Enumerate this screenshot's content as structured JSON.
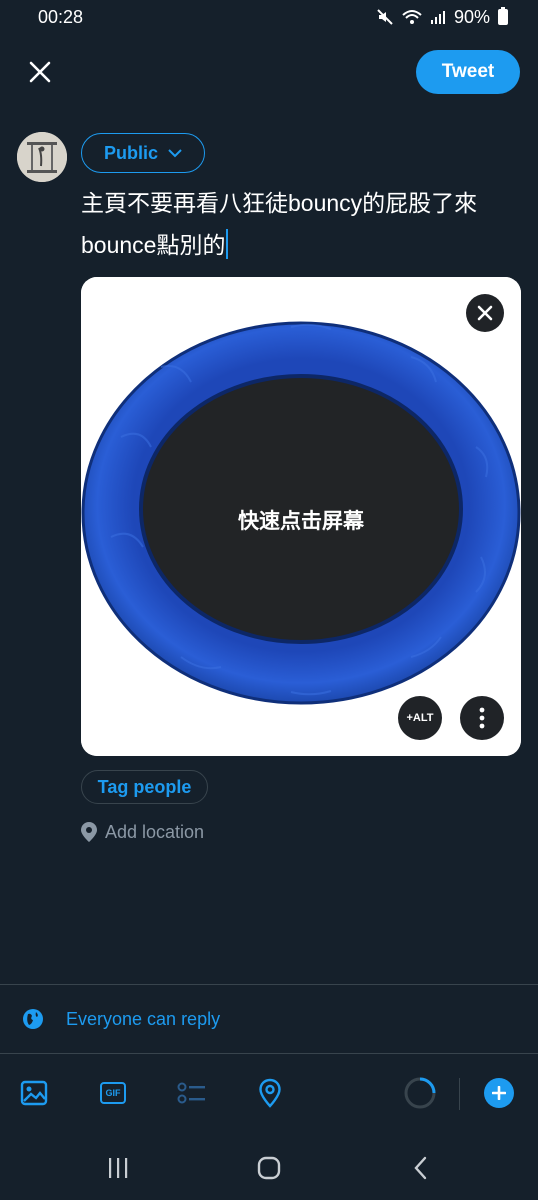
{
  "status_bar": {
    "time": "00:28",
    "battery": "90%"
  },
  "header": {
    "tweet_label": "Tweet"
  },
  "composer": {
    "audience_label": "Public",
    "text_line1": "主頁不要再看八狂徒bouncy的屁股了來",
    "text_line2": "bounce點別的"
  },
  "media": {
    "overlay_text": "快速点击屏幕",
    "alt_label": "+ALT"
  },
  "actions": {
    "tag_people": "Tag people",
    "add_location": "Add location"
  },
  "reply_settings": {
    "label": "Everyone can reply"
  },
  "colors": {
    "background": "#15202b",
    "accent": "#1d9bf0",
    "muted": "#8b98a5",
    "divider": "#38444d"
  },
  "icons": {
    "close": "close-icon",
    "chevron": "chevron-down-icon",
    "image": "image-icon",
    "gif": "gif-icon",
    "poll": "poll-icon",
    "location": "location-pin-icon",
    "globe": "globe-icon",
    "add": "plus-icon"
  }
}
